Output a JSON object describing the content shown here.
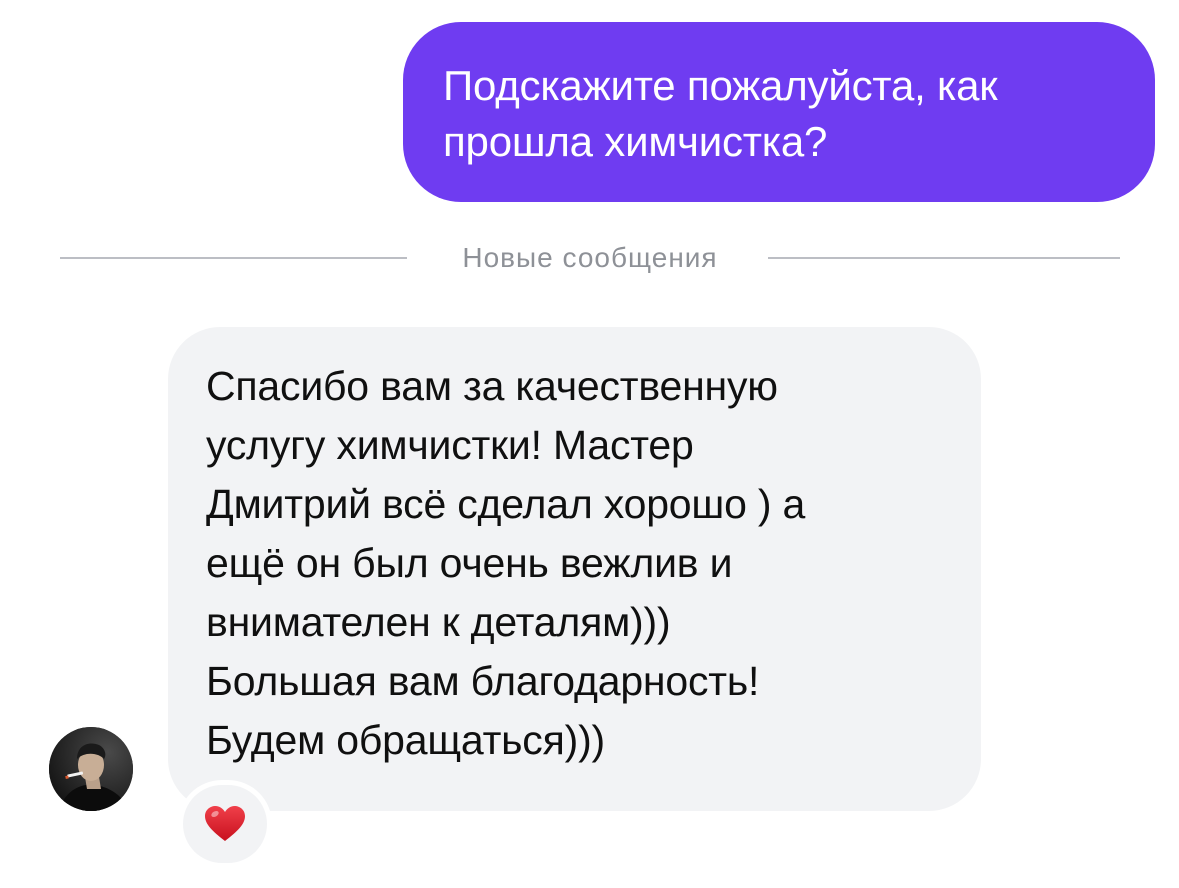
{
  "outgoing_message": {
    "lines": [
      "Подскажите пожалуйста, как",
      "прошла химчистка?"
    ],
    "bubble_color": "#6f3cf1",
    "text_color": "#ffffff"
  },
  "divider": {
    "label": "Новые сообщения"
  },
  "incoming_message": {
    "lines": [
      "Спасибо вам за качественную",
      "услугу химчистки! Мастер",
      "Дмитрий всё сделал хорошо ) а",
      "ещё он был очень вежлив и",
      "внимателен к деталям)))",
      "Большая вам благодарность!",
      "Будем обращаться)))"
    ],
    "bubble_color": "#f2f3f5"
  },
  "sender": {
    "avatar_icon": "user-avatar"
  },
  "reaction": {
    "icon": "red-heart-icon",
    "color": "#e0202f"
  }
}
